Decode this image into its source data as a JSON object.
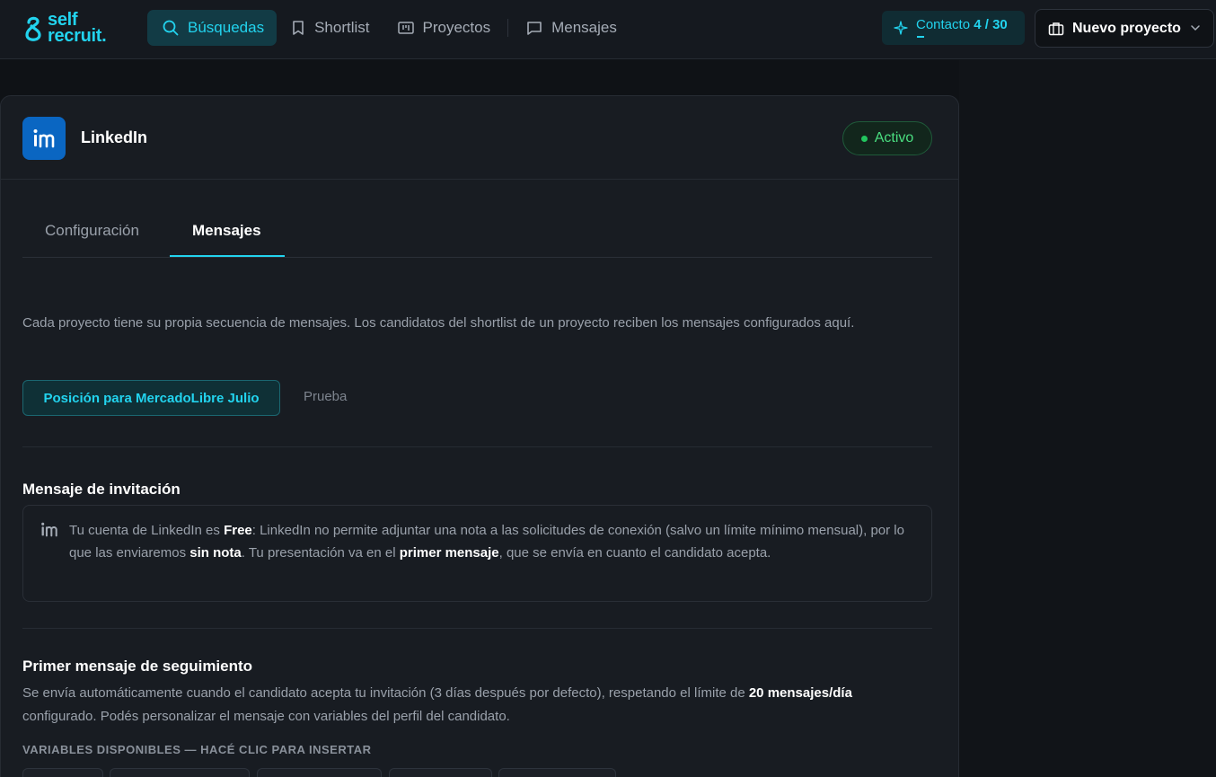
{
  "app": {
    "logo_line1": "self",
    "logo_line2": "recruit.",
    "accent_color": "#22d3ee"
  },
  "nav": {
    "items": [
      {
        "label": "Búsquedas",
        "icon": "search-icon",
        "active": true
      },
      {
        "label": "Shortlist",
        "icon": "bookmark-icon",
        "active": false
      },
      {
        "label": "Proyectos",
        "icon": "kanban-icon",
        "active": false
      },
      {
        "label": "Mensajes",
        "icon": "message-icon",
        "active": false
      }
    ]
  },
  "contact": {
    "label": "Contacto",
    "count": "4 / 30",
    "icon": "sparkle-icon"
  },
  "project_selector": {
    "label": "Nuevo proyecto",
    "icon": "briefcase-icon"
  },
  "integration": {
    "name": "LinkedIn",
    "status": "Activo",
    "status_color": "#4ade80"
  },
  "tabs": [
    {
      "label": "Configuración",
      "active": false
    },
    {
      "label": "Mensajes",
      "active": true
    }
  ],
  "intro": "Cada proyecto tiene su propia secuencia de mensajes. Los candidatos del shortlist de un proyecto reciben los mensajes configurados aquí.",
  "project_tabs": [
    {
      "label": "Posición para MercadoLibre Julio",
      "active": true
    },
    {
      "label": "Prueba",
      "active": false
    }
  ],
  "invitation": {
    "title": "Mensaje de invitación",
    "notice_parts": [
      "Tu cuenta de LinkedIn es ",
      "Free",
      ": LinkedIn no permite adjuntar una nota a las solicitudes de conexión (salvo un límite mínimo mensual), por lo que las enviaremos ",
      "sin nota",
      ". Tu presentación va en el ",
      "primer mensaje",
      ", que se envía en cuanto el candidato acepta."
    ]
  },
  "followup": {
    "title": "Primer mensaje de seguimiento",
    "desc_parts": [
      "Se envía automáticamente cuando el candidato acepta tu invitación (3 días después por defecto), respetando el límite de ",
      "20 mensajes/día",
      " configurado. Podés personalizar el mensaje con variables del perfil del candidato."
    ],
    "vars_label": "VARIABLES DISPONIBLES — HACÉ CLIC PARA INSERTAR"
  }
}
